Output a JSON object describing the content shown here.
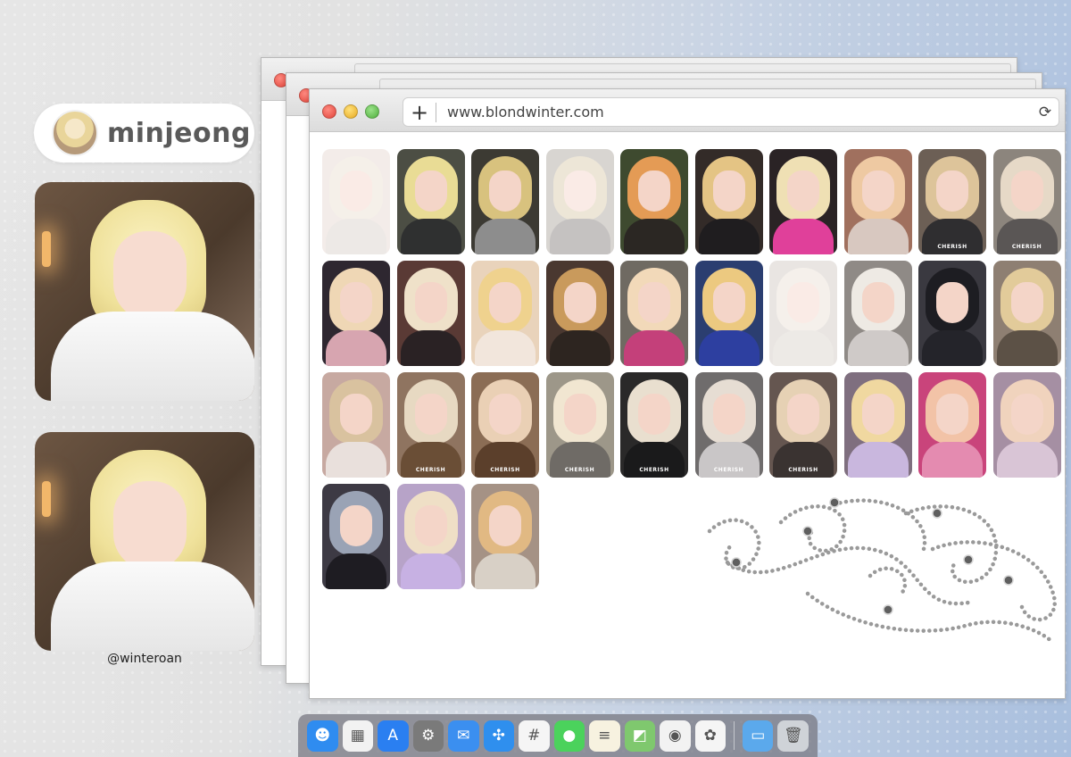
{
  "profile": {
    "name": "minjeong",
    "handle": "@winteroan"
  },
  "browser": {
    "url": "www.blondwinter.com",
    "new_tab_glyph": "+",
    "reload_glyph": "⟳"
  },
  "photocards": [
    {
      "label": "",
      "faded": true,
      "hair": "#eadfcf",
      "bg": "#e6d7d0",
      "top": "#d9cfc9"
    },
    {
      "label": "",
      "faded": false,
      "hair": "#e9dc95",
      "bg": "#4c4e44",
      "top": "#2f3030"
    },
    {
      "label": "",
      "faded": false,
      "hair": "#d8c27e",
      "bg": "#3c3a33",
      "top": "#8d8d8d"
    },
    {
      "label": "",
      "faded": true,
      "hair": "#d9c9a8",
      "bg": "#aaa39b",
      "top": "#7f7a78"
    },
    {
      "label": "",
      "faded": false,
      "hair": "#e49b55",
      "bg": "#3e4a2f",
      "top": "#2b2723"
    },
    {
      "label": "",
      "faded": false,
      "hair": "#e4c484",
      "bg": "#332b28",
      "top": "#1f1d1f"
    },
    {
      "label": "",
      "faded": false,
      "hair": "#efe0b4",
      "bg": "#2a2325",
      "top": "#e0409a"
    },
    {
      "label": "",
      "faded": false,
      "hair": "#eec9a2",
      "bg": "#a0705e",
      "top": "#d8c8c0"
    },
    {
      "label": "CHERISH",
      "faded": false,
      "hair": "#ddc49a",
      "bg": "#6c5f55",
      "top": "#2f2e30"
    },
    {
      "label": "CHERISH",
      "faded": false,
      "hair": "#e6d9c7",
      "bg": "#8c857d",
      "top": "#5a5655"
    },
    {
      "label": "",
      "faded": false,
      "hair": "#efd7b5",
      "bg": "#2e2730",
      "top": "#d7a5b0"
    },
    {
      "label": "",
      "faded": false,
      "hair": "#efe1c9",
      "bg": "#5a3a35",
      "top": "#2a2224"
    },
    {
      "label": "",
      "faded": false,
      "hair": "#efd28e",
      "bg": "#e9d3bb",
      "top": "#f2e6dc"
    },
    {
      "label": "",
      "faded": false,
      "hair": "#c99a5c",
      "bg": "#4a3830",
      "top": "#2d2520"
    },
    {
      "label": "",
      "faded": false,
      "hair": "#f2d9b9",
      "bg": "#6f6a62",
      "top": "#c4407a"
    },
    {
      "label": "",
      "faded": false,
      "hair": "#ecc980",
      "bg": "#2b3e70",
      "top": "#2d3fa0"
    },
    {
      "label": "",
      "faded": true,
      "hair": "#e9e0d5",
      "bg": "#cfc7bf",
      "top": "#d8d1ca"
    },
    {
      "label": "",
      "faded": false,
      "hair": "#eeeae4",
      "bg": "#8f8a86",
      "top": "#cfcac8"
    },
    {
      "label": "",
      "faded": false,
      "hair": "#1d1d22",
      "bg": "#3a3940",
      "top": "#24242a"
    },
    {
      "label": "",
      "faded": false,
      "hair": "#e2cb9a",
      "bg": "#8e7f72",
      "top": "#5c5146"
    },
    {
      "label": "",
      "faded": false,
      "hair": "#d9c29f",
      "bg": "#c7a9a1",
      "top": "#e9e0dc"
    },
    {
      "label": "CHERISH",
      "faded": false,
      "hair": "#e7d9c2",
      "bg": "#8f7460",
      "top": "#6a4e36"
    },
    {
      "label": "CHERISH",
      "faded": false,
      "hair": "#ead0b5",
      "bg": "#8b6d55",
      "top": "#5b3f2b"
    },
    {
      "label": "CHERISH",
      "faded": false,
      "hair": "#f1e6d1",
      "bg": "#9d9789",
      "top": "#6f6b66"
    },
    {
      "label": "CHERISH",
      "faded": false,
      "hair": "#e9dfcf",
      "bg": "#2a2929",
      "top": "#1a1a1b"
    },
    {
      "label": "CHERISH",
      "faded": false,
      "hair": "#e6ddd3",
      "bg": "#6f6c6c",
      "top": "#c9c6c7"
    },
    {
      "label": "CHERISH",
      "faded": false,
      "hair": "#e6d1b4",
      "bg": "#655650",
      "top": "#3a3331"
    },
    {
      "label": "",
      "faded": false,
      "hair": "#f0d8a0",
      "bg": "#7f6f7f",
      "top": "#c9b7de"
    },
    {
      "label": "",
      "faded": false,
      "hair": "#f2c3a7",
      "bg": "#c9447b",
      "top": "#e48bb0"
    },
    {
      "label": "",
      "faded": false,
      "hair": "#f0d3bd",
      "bg": "#a58fa3",
      "top": "#d9c5d6"
    },
    {
      "label": "",
      "faded": false,
      "hair": "#9aa3b5",
      "bg": "#3d3a44",
      "top": "#1e1c22"
    },
    {
      "label": "",
      "faded": false,
      "hair": "#efdfc6",
      "bg": "#b7a3c8",
      "top": "#c7b1e3"
    },
    {
      "label": "",
      "faded": false,
      "hair": "#e1b983",
      "bg": "#a59285",
      "top": "#d8d0c6"
    }
  ],
  "dock": [
    {
      "name": "finder-icon",
      "glyph": "☻",
      "color": "#2f8cf0"
    },
    {
      "name": "launchpad-icon",
      "glyph": "▦",
      "color": "#f2f2f2"
    },
    {
      "name": "app-store-icon",
      "glyph": "A",
      "color": "#2a7ff1"
    },
    {
      "name": "system-settings-icon",
      "glyph": "⚙",
      "color": "#7a7a7a"
    },
    {
      "name": "mail-icon",
      "glyph": "✉",
      "color": "#3b8ff0"
    },
    {
      "name": "safari-icon",
      "glyph": "✣",
      "color": "#2f8fee"
    },
    {
      "name": "slack-icon",
      "glyph": "#",
      "color": "#f5f5f5"
    },
    {
      "name": "messages-icon",
      "glyph": "●",
      "color": "#4bd25c"
    },
    {
      "name": "notes-icon",
      "glyph": "≡",
      "color": "#f7f2e0"
    },
    {
      "name": "maps-icon",
      "glyph": "◩",
      "color": "#7fc86e"
    },
    {
      "name": "chrome-icon",
      "glyph": "◉",
      "color": "#f2f2f2"
    },
    {
      "name": "photos-icon",
      "glyph": "✿",
      "color": "#f5f5f5"
    },
    {
      "name": "folder-icon",
      "glyph": "▭",
      "color": "#5ba9ec"
    },
    {
      "name": "trash-icon",
      "glyph": "🗑",
      "color": "#cfd3d8"
    }
  ]
}
